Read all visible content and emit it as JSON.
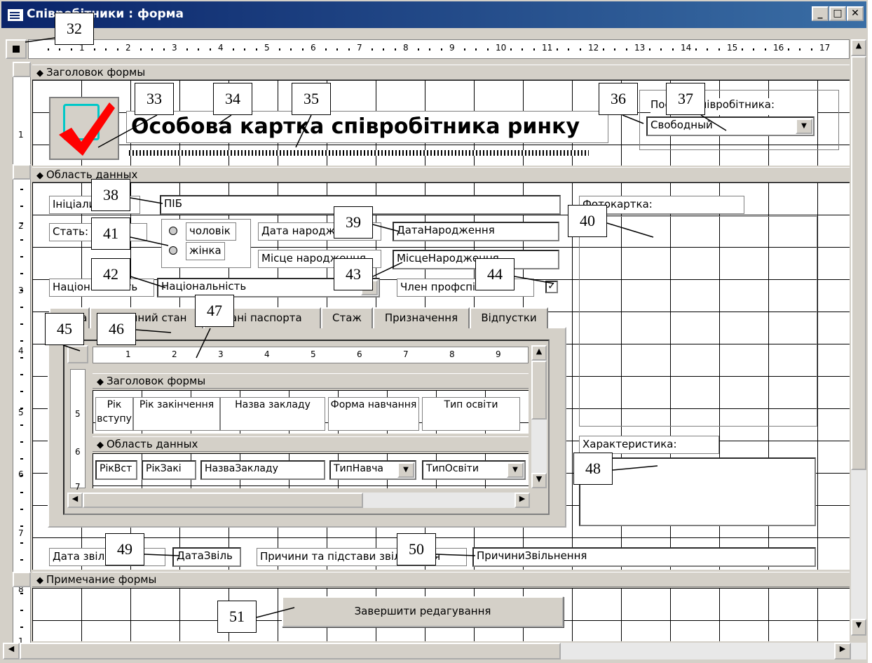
{
  "window": {
    "title": "Співробітники : форма"
  },
  "ruler_top": [
    "1",
    "2",
    "3",
    "4",
    "5",
    "6",
    "7",
    "8",
    "9",
    "10",
    "11",
    "12",
    "13",
    "14",
    "15",
    "16",
    "17"
  ],
  "ruler_left": [
    "1",
    "2",
    "3",
    "4",
    "5",
    "6",
    "7",
    "8",
    "1"
  ],
  "sections": {
    "header": "Заголовок формы",
    "detail": "Область данных",
    "footer": "Примечание формы"
  },
  "header": {
    "title": "Особова картка співробітника ринку",
    "status_label": "Посада співробітника:",
    "status_value": "Свободный"
  },
  "detail": {
    "initials_label": "Ініціали",
    "initials_value": "ПІБ",
    "sex_label": "Стать:",
    "sex_options": [
      "чоловік",
      "жінка"
    ],
    "birthdate_label": "Дата народження",
    "birthdate_value": "ДатаНародження",
    "birthplace_label": "Місце народження",
    "birthplace_value": "МісцеНародження",
    "nationality_label": "Національність",
    "nationality_value": "Національність",
    "union_label": "Член профспілки",
    "photo_label": "Фотокартка:",
    "characteristic_label": "Характеристика:",
    "dismiss_date_label": "Дата звільнення",
    "dismiss_date_value": "ДатаЗвіль",
    "dismiss_reason_label": "Причини та підстави звільнення",
    "dismiss_reason_value": "ПричиниЗвільнення"
  },
  "tabs": [
    "Освіта",
    "Сімейний стан",
    "Дані паспорта",
    "Стаж",
    "Призначення",
    "Відпустки"
  ],
  "subform": {
    "ruler": [
      "1",
      "2",
      "3",
      "4",
      "5",
      "6",
      "7",
      "8",
      "9"
    ],
    "ruler_left": [
      "5",
      "6",
      "7"
    ],
    "header_section": "Заголовок формы",
    "detail_section": "Область данных",
    "columns": [
      "Рік вступу",
      "Рік закінчення",
      "Назва закладу",
      "Форма навчання",
      "Тип освіти"
    ],
    "fields": [
      "РікВст",
      "РікЗакі",
      "НазваЗакладу",
      "ТипНавча",
      "ТипОсвіти"
    ]
  },
  "footer": {
    "finish_button": "Завершити редагування"
  },
  "callouts": [
    "32",
    "33",
    "34",
    "35",
    "36",
    "37",
    "38",
    "39",
    "40",
    "41",
    "42",
    "43",
    "44",
    "45",
    "46",
    "47",
    "48",
    "49",
    "50",
    "51"
  ]
}
